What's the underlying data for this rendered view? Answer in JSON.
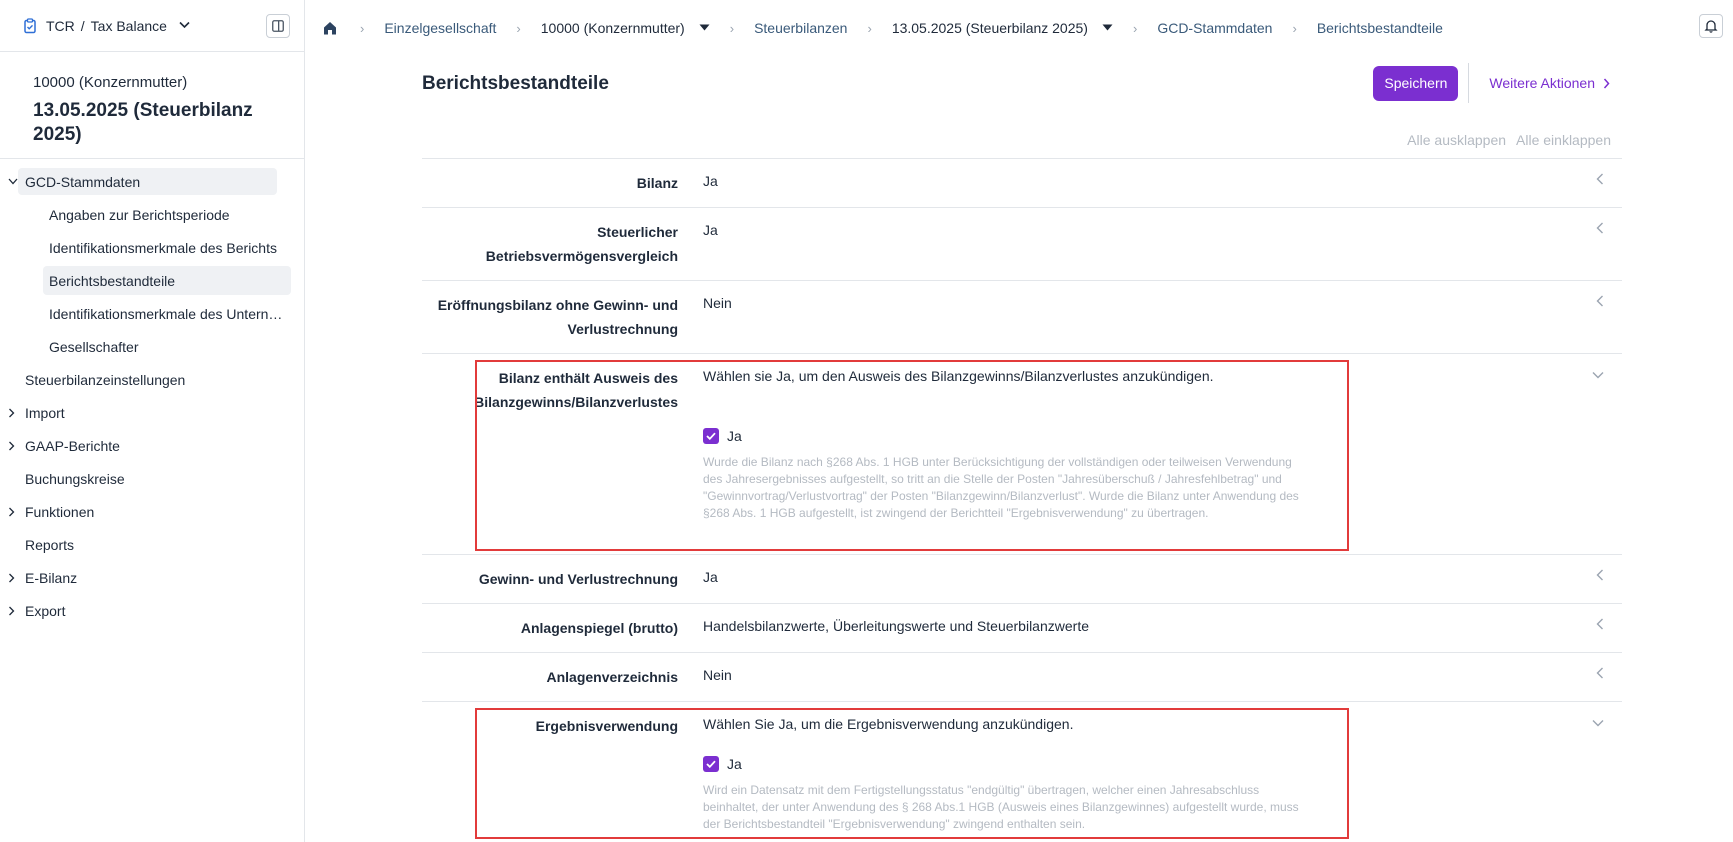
{
  "sidebar": {
    "app_title": "TCR",
    "app_sep": "/",
    "app_sub": "Tax Balance",
    "entity": "10000 (Konzernmutter)",
    "period": "13.05.2025 (Steuerbilanz 2025)",
    "items": [
      {
        "label": "GCD-Stammdaten"
      },
      {
        "label": "Angaben zur Berichtsperiode"
      },
      {
        "label": "Identifikationsmerkmale des Berichts"
      },
      {
        "label": "Berichtsbestandteile"
      },
      {
        "label": "Identifikationsmerkmale des Untern…"
      },
      {
        "label": "Gesellschafter"
      },
      {
        "label": "Steuerbilanzeinstellungen"
      },
      {
        "label": "Import"
      },
      {
        "label": "GAAP-Berichte"
      },
      {
        "label": "Buchungskreise"
      },
      {
        "label": "Funktionen"
      },
      {
        "label": "Reports"
      },
      {
        "label": "E-Bilanz"
      },
      {
        "label": "Export"
      }
    ]
  },
  "breadcrumb": {
    "items": [
      "Einzelgesellschaft",
      "10000 (Konzernmutter)",
      "Steuerbilanzen",
      "13.05.2025 (Steuerbilanz 2025)",
      "GCD-Stammdaten",
      "Berichtsbestandteile"
    ]
  },
  "main": {
    "title": "Berichtsbestandteile",
    "save_label": "Speichern",
    "more_label": "Weitere Aktionen",
    "expand_all": "Alle ausklappen",
    "collapse_all": "Alle einklappen",
    "rows": [
      {
        "label": "Bilanz",
        "value": "Ja"
      },
      {
        "label": "Steuerlicher Betriebsvermögensvergleich",
        "value": "Ja"
      },
      {
        "label": "Eröffnungsbilanz ohne Gewinn- und Verlustrechnung",
        "value": "Nein"
      },
      {
        "label": "Bilanz enthält Ausweis des Bilanzgewinns/Bilanzverlustes",
        "desc": "Wählen sie Ja, um den Ausweis des Bilanzgewinns/Bilanzverlustes anzukündigen.",
        "checkbox": "Ja",
        "hint": "Wurde die Bilanz nach §268 Abs. 1 HGB unter Berücksichtigung der vollständigen oder teilweisen Verwendung des Jahresergebnisses aufgestellt, so tritt an die Stelle der Posten \"Jahresüberschuß / Jahresfehlbetrag\" und \"Gewinnvortrag/Verlustvortrag\" der Posten \"Bilanzgewinn/Bilanzverlust\". Wurde die Bilanz unter Anwendung des §268 Abs. 1 HGB aufgestellt, ist zwingend der Berichtteil \"Ergebnisverwendung\" zu übertragen."
      },
      {
        "label": "Gewinn- und Verlustrechnung",
        "value": "Ja"
      },
      {
        "label": "Anlagenspiegel (brutto)",
        "value": "Handelsbilanzwerte, Überleitungswerte und Steuerbilanzwerte"
      },
      {
        "label": "Anlagenverzeichnis",
        "value": "Nein"
      },
      {
        "label": "Ergebnisverwendung",
        "desc": "Wählen Sie Ja, um die Ergebnisverwendung anzukündigen.",
        "checkbox": "Ja",
        "hint": "Wird ein Datensatz mit dem Fertigstellungsstatus \"endgültig\" übertragen, welcher einen Jahresabschluss beinhaltet, der unter Anwendung des § 268 Abs.1 HGB (Ausweis eines Bilanzgewinnes) aufgestellt wurde, muss der Berichtsbestandteil \"Ergebnisverwendung\" zwingend enthalten sein."
      }
    ]
  },
  "colors": {
    "accent": "#7b2fd0",
    "highlight": "#e23b3b"
  }
}
